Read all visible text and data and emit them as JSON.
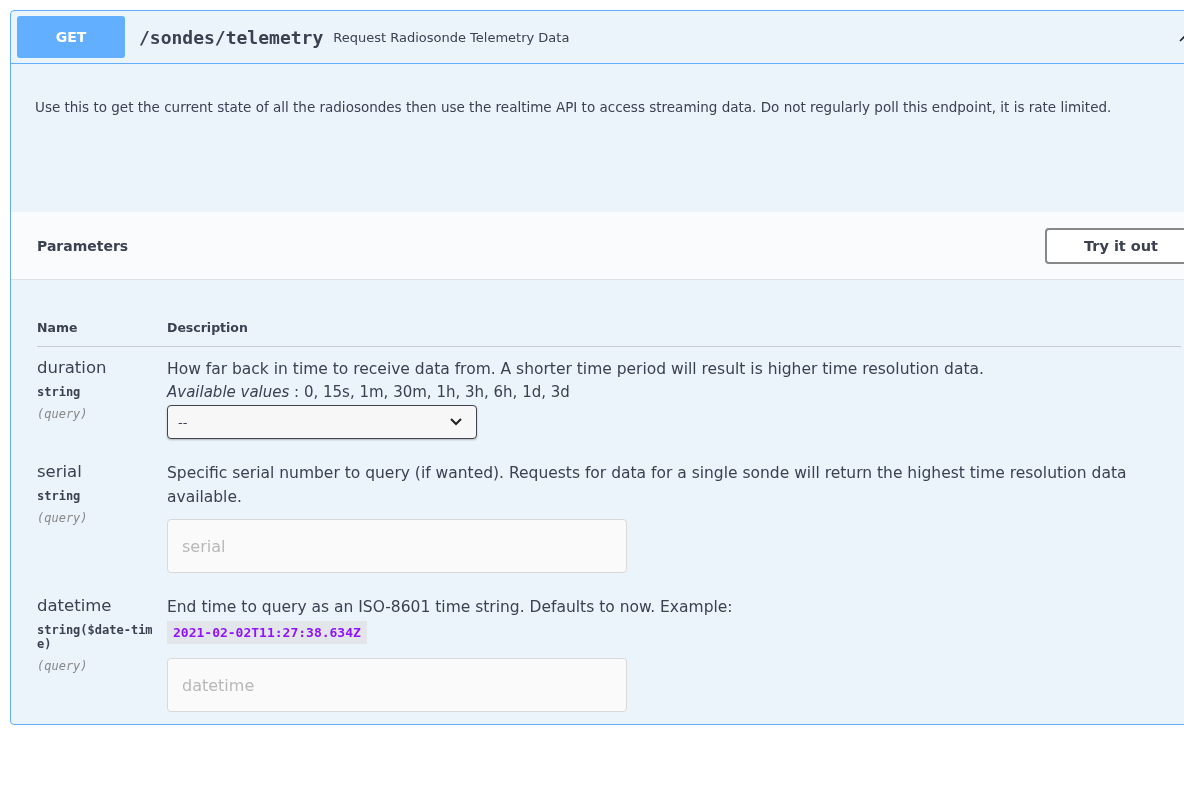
{
  "operation": {
    "method": "GET",
    "path": "/sondes/telemetry",
    "summary": "Request Radiosonde Telemetry Data",
    "expanded": true,
    "description": "Use this to get the current state of all the radiosondes then use the realtime API to access streaming data. Do not regularly poll this endpoint, it is rate limited."
  },
  "parameters_section": {
    "title": "Parameters",
    "try_button": "Try it out"
  },
  "table": {
    "columns": [
      "Name",
      "Description"
    ],
    "rows": [
      {
        "name": "duration",
        "type": "string",
        "location": "(query)",
        "description": "How far back in time to receive data from. A shorter time period will result is higher time resolution data.",
        "available": "*Available values* : 0, 15s, 1m, 30m, 1h, 3h, 6h, 1d, 3d",
        "kind": "select",
        "value": "--"
      },
      {
        "name": "serial",
        "type": "string",
        "location": "(query)",
        "description": "Specific serial number to query (if wanted). Requests for data for a single sonde will return the highest time resolution data available.",
        "kind": "text",
        "placeholder": "serial"
      },
      {
        "name": "datetime",
        "type": "string($date-time)",
        "location": "(query)",
        "description": "End time to query as an ISO-8601 time string. Defaults to now. Example:",
        "example": "2021-02-02T11:27:38.634Z",
        "kind": "text",
        "placeholder": "datetime"
      }
    ]
  }
}
